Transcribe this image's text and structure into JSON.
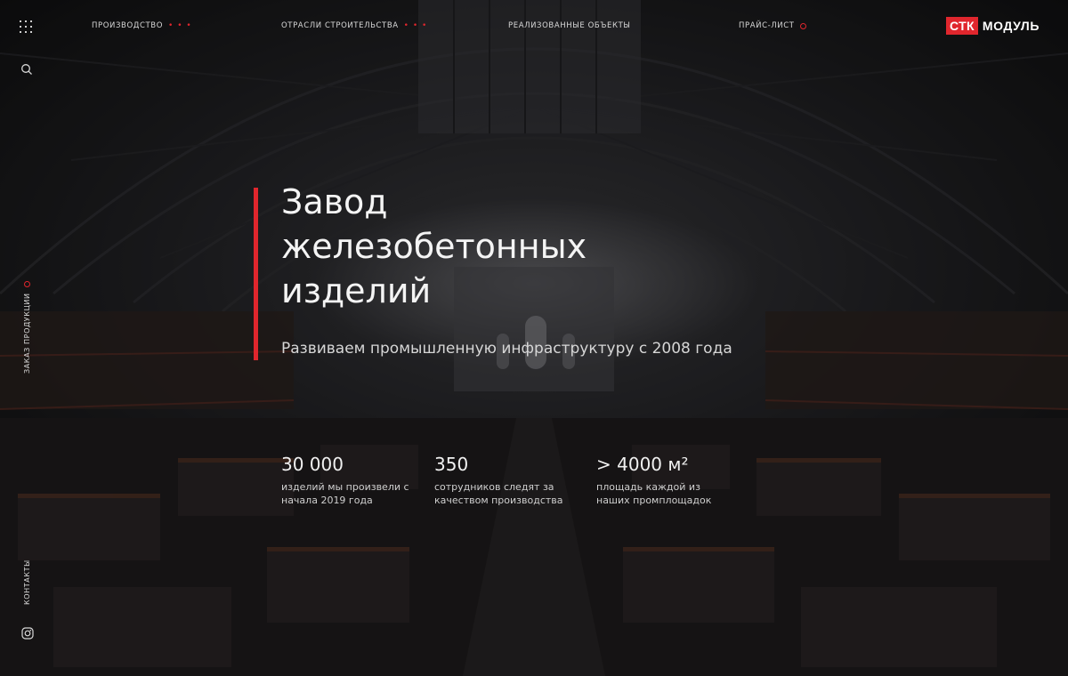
{
  "header": {
    "nav": [
      {
        "label": "Производство",
        "marker": "dots"
      },
      {
        "label": "Отрасли строительства",
        "marker": "dots"
      },
      {
        "label": "Реализованные объекты",
        "marker": "none"
      },
      {
        "label": "Прайс-лист",
        "marker": "ring"
      }
    ],
    "logo": {
      "mark": "СТК",
      "word": "МОДУЛЬ"
    }
  },
  "icons": {
    "menu": "grid-dots-icon",
    "search": "search-icon",
    "instagram": "instagram-icon"
  },
  "sidebar": {
    "order_label": "Заказ продукции",
    "contacts_label": "Контакты"
  },
  "hero": {
    "title_lines": [
      "Завод",
      "железобетонных",
      "изделий"
    ],
    "subtitle": "Развиваем промышленную инфраструктуру с 2008 года"
  },
  "stats": [
    {
      "value": "30 000",
      "desc": "изделий мы произвели с начала 2019 года"
    },
    {
      "value": "350",
      "desc": "сотрудников следят за качеством производства"
    },
    {
      "value": "> 4000 м²",
      "desc": "площадь каждой из наших промплощадок"
    }
  ],
  "colors": {
    "accent": "#e0262d",
    "background": "#141414",
    "text": "#f4f4f4"
  }
}
